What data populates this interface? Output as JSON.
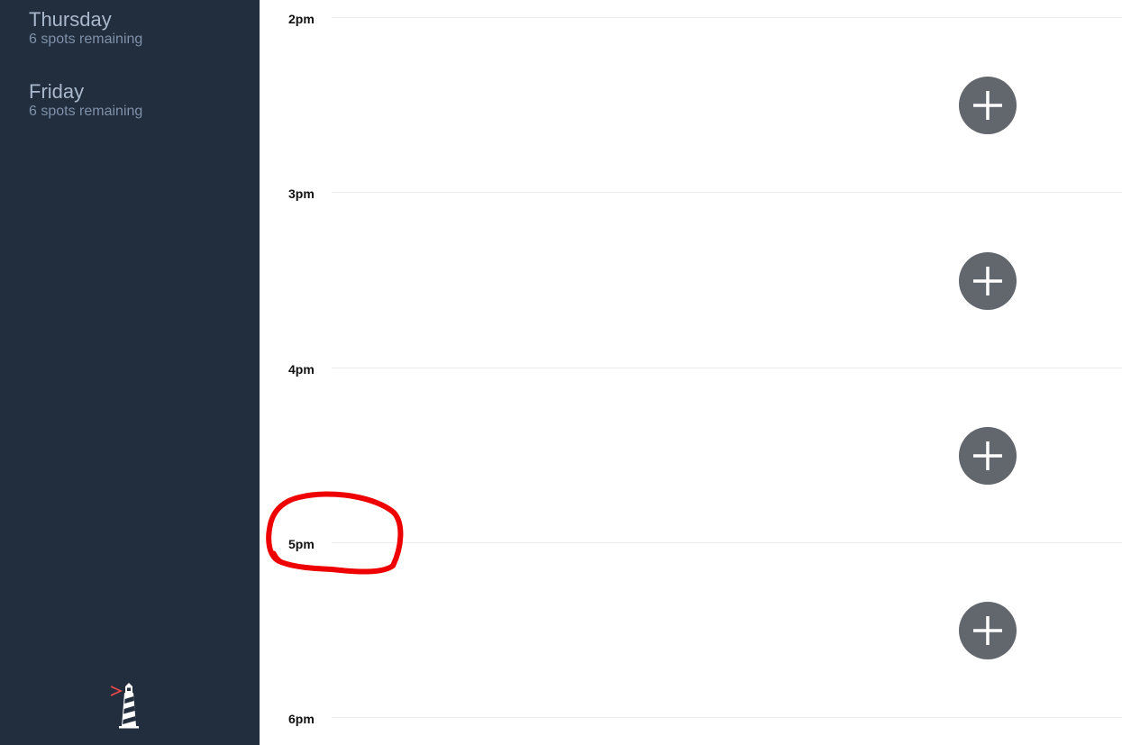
{
  "sidebar": {
    "days": [
      {
        "name": "Thursday",
        "spots": "6 spots remaining"
      },
      {
        "name": "Friday",
        "spots": "6 spots remaining"
      }
    ],
    "logo_icon": "lighthouse-icon"
  },
  "schedule": {
    "hours": [
      "2pm",
      "3pm",
      "4pm",
      "5pm",
      "6pm"
    ],
    "add_button_icon": "plus-icon",
    "add_button_count": 4
  },
  "annotation": {
    "shape": "hand-drawn-circle",
    "color": "#ee0000",
    "target_hour": "5pm"
  },
  "colors": {
    "sidebar_bg": "#222d3d",
    "day_name": "#a9b8cc",
    "day_spots": "#7f91a8",
    "add_button": "#62666d",
    "logo_accent": "#e04848"
  }
}
